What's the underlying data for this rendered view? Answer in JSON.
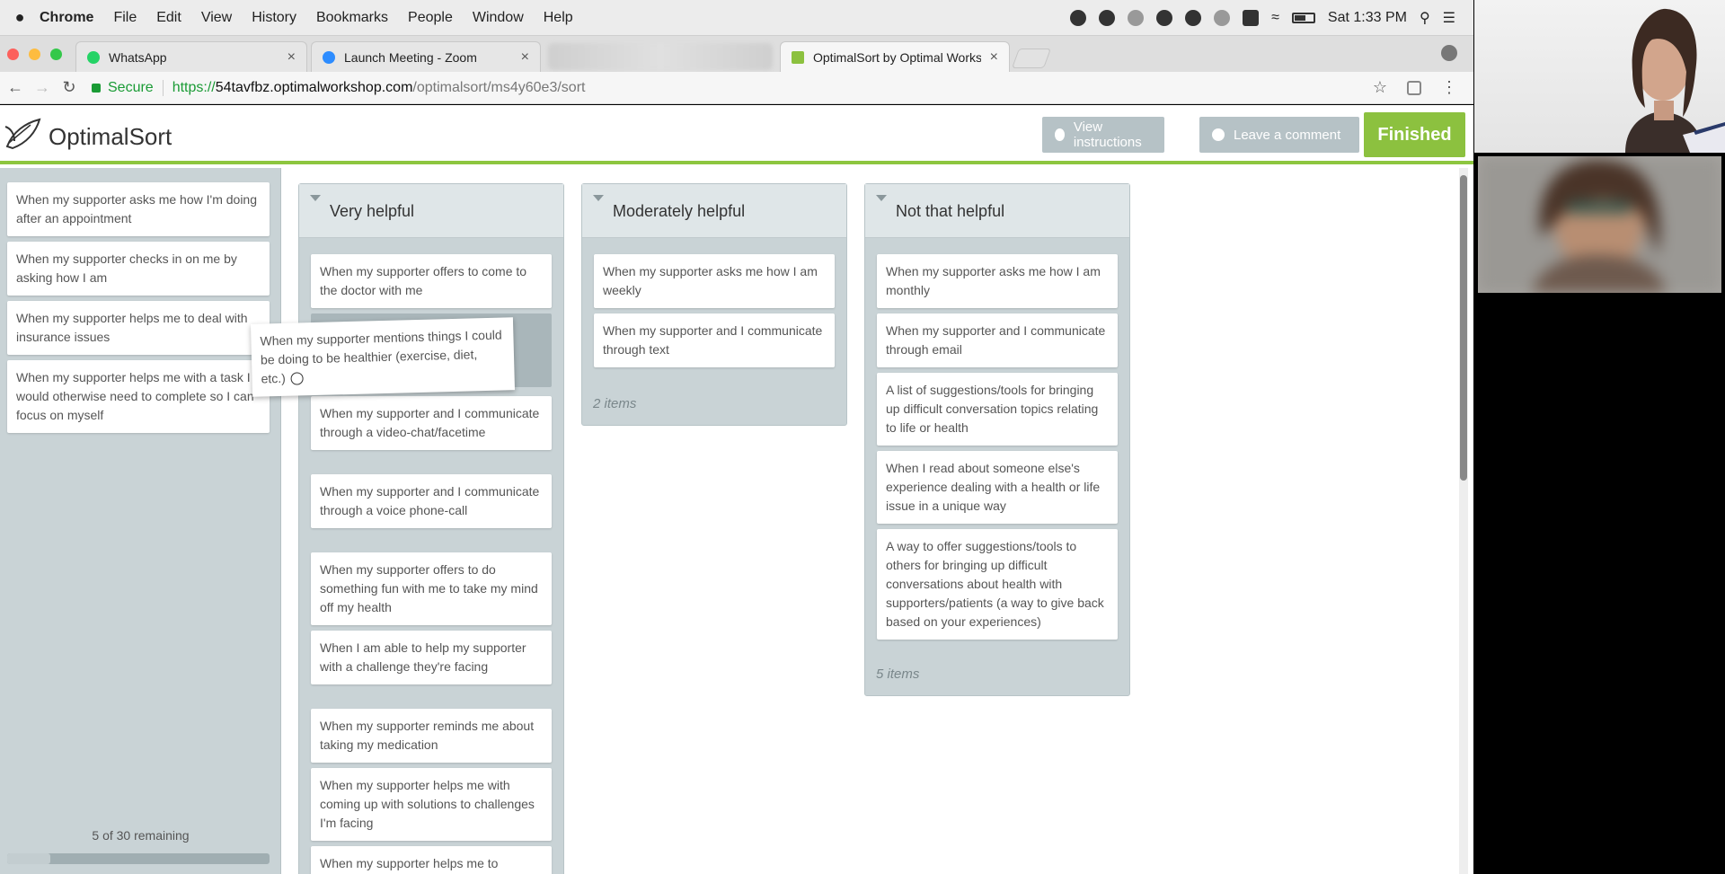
{
  "menubar": {
    "app": "Chrome",
    "items": [
      "File",
      "Edit",
      "View",
      "History",
      "Bookmarks",
      "People",
      "Window",
      "Help"
    ],
    "clock": "Sat 1:33 PM"
  },
  "tabs": [
    {
      "label": "WhatsApp",
      "icon": "whatsapp-icon",
      "color": "#25d366"
    },
    {
      "label": "Launch Meeting - Zoom",
      "icon": "zoom-icon",
      "color": "#2d8cff"
    },
    {
      "label": "OptimalSort by Optimal Works",
      "icon": "optimalsort-icon",
      "color": "#8cc13f"
    }
  ],
  "address": {
    "secure_label": "Secure",
    "scheme": "https://",
    "host": "54tavfbz.optimalworkshop.com",
    "path": "/optimalsort/ms4y60e3/sort"
  },
  "app": {
    "logo_text": "OptimalSort",
    "view_instructions": "View instructions",
    "leave_comment": "Leave a comment",
    "finished": "Finished",
    "accent": "#8cc13f"
  },
  "unsorted": {
    "cards": [
      "When my supporter asks me how I'm doing after an appointment",
      "When my supporter checks in on me by asking how I am",
      "When my supporter helps me to deal with insurance issues",
      "When my supporter helps me with a task I would otherwise need to complete so I can focus on myself"
    ],
    "remaining": "5 of 30 remaining"
  },
  "dragging_card": "When my supporter mentions things I could be doing to be healthier (exercise, diet, etc.)",
  "columns": [
    {
      "title": "Very helpful",
      "cards": [
        "When my supporter offers to come to the doctor with me",
        "When my supporter and I communicate through a video-chat/facetime",
        "When my supporter and I communicate through a voice phone-call",
        "When my supporter offers to do something fun with me to take my mind off my health",
        "When I am able to help my supporter with a challenge they're facing",
        "When my supporter reminds me about taking my medication",
        "When my supporter helps me with coming up with solutions to challenges I'm facing",
        "When my supporter helps me to"
      ]
    },
    {
      "title": "Moderately helpful",
      "cards": [
        "When my supporter asks me how I am weekly",
        "When my supporter and I communicate through text"
      ],
      "count": "2 items"
    },
    {
      "title": "Not that helpful",
      "cards": [
        "When my supporter asks me how I am monthly",
        "When my supporter and I communicate through email",
        "A list of suggestions/tools for bringing up difficult conversation topics relating to life or health",
        "When I read about someone else's experience dealing with a health or life issue in a unique way",
        "A way to offer suggestions/tools to others for bringing up difficult conversations about health with supporters/patients (a way to give back based on your experiences)"
      ],
      "count": "5 items"
    }
  ]
}
